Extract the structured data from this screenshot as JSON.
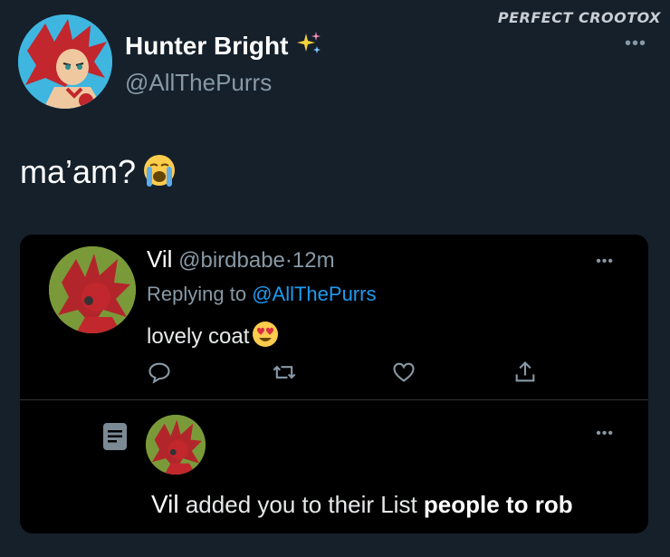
{
  "watermark": "PERFECT CROOTOX",
  "header": {
    "name": "Hunter Bright",
    "handle": "@AllThePurrs",
    "more_icon": "more-horizontal-icon"
  },
  "tweet": {
    "text": "ma’am?",
    "emoji": "loudly-crying-face"
  },
  "reply": {
    "name": "Vil",
    "handle": "@birdbabe",
    "separator": "·",
    "time": "12m",
    "replying_prefix": "Replying to",
    "replying_to": "@AllThePurrs",
    "text": "lovely coat",
    "emoji": "heart-eyes-face",
    "actions": [
      "reply-icon",
      "retweet-icon",
      "like-icon",
      "share-icon"
    ]
  },
  "notification": {
    "name": "Vil",
    "text": " added you to their List ",
    "list_name": "people to rob"
  },
  "colors": {
    "background": "#15202b",
    "card_background": "#000000",
    "accent": "#1d9bf0",
    "secondary_text": "#8899a6"
  }
}
